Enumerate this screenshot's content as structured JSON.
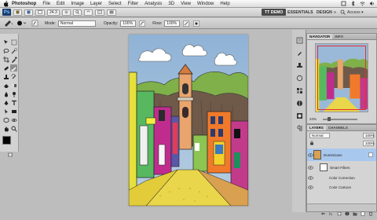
{
  "menubar": {
    "app_name": "Photoshop",
    "items": [
      "File",
      "Edit",
      "Image",
      "Layer",
      "Select",
      "Filter",
      "Analysis",
      "3D",
      "View",
      "Window",
      "Help"
    ],
    "icons": [
      "apple-icon",
      "script-icon",
      "bluetooth-icon",
      "wifi-icon",
      "volume-icon"
    ]
  },
  "appbar": {
    "logo_text": "Ps",
    "zoom": "24.3",
    "workspace_tabs": [
      "TT DEMO",
      "ESSENTIALS",
      "DESIGN"
    ],
    "active_workspace": "TT DEMO",
    "more": "»",
    "access": "Access ▾"
  },
  "options": {
    "mode_label": "Mode:",
    "mode_value": "Normal",
    "opacity_label": "Opacity:",
    "opacity_value": "100%",
    "flow_label": "Flow:",
    "flow_value": "100%"
  },
  "navigator": {
    "tabs": [
      "NAVIGATOR",
      "INFO"
    ],
    "zoom": "24%"
  },
  "layers": {
    "tabs": [
      "LAYERS",
      "CHANNELS"
    ],
    "blend": "Normal",
    "opacity": "100%",
    "fill": "100%",
    "rows": [
      {
        "label": "Dominicans"
      },
      {
        "label": "Smart Filters"
      },
      {
        "label": "Color Correction"
      },
      {
        "label": "Color Cartoon"
      }
    ]
  },
  "colors": {
    "accent": "#a9c8ee",
    "brand": "#1b3d6d"
  }
}
